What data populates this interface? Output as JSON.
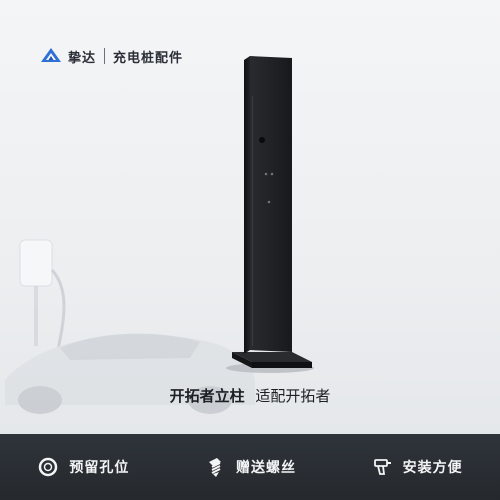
{
  "brand": {
    "logo_icon": "brand-diamond-logo-icon",
    "name": "挚达",
    "subtitle": "充电桩配件"
  },
  "product": {
    "title": "开拓者立柱",
    "subtitle": "适配开拓者"
  },
  "features": [
    {
      "icon": "ring-icon",
      "label": "预留孔位"
    },
    {
      "icon": "screw-icon",
      "label": "赠送螺丝"
    },
    {
      "icon": "drill-icon",
      "label": "安装方便"
    }
  ],
  "colors": {
    "brand_blue": "#2f6fd8",
    "dark_bar": "#2b2f35",
    "post": "#1b1c1f"
  }
}
